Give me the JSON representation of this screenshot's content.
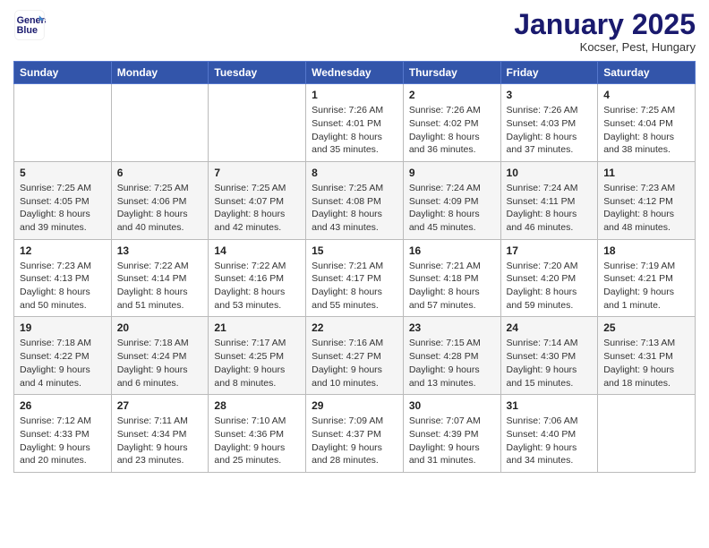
{
  "header": {
    "logo_line1": "General",
    "logo_line2": "Blue",
    "month": "January 2025",
    "location": "Kocser, Pest, Hungary"
  },
  "weekdays": [
    "Sunday",
    "Monday",
    "Tuesday",
    "Wednesday",
    "Thursday",
    "Friday",
    "Saturday"
  ],
  "weeks": [
    [
      {
        "day": "",
        "info": ""
      },
      {
        "day": "",
        "info": ""
      },
      {
        "day": "",
        "info": ""
      },
      {
        "day": "1",
        "info": "Sunrise: 7:26 AM\nSunset: 4:01 PM\nDaylight: 8 hours and 35 minutes."
      },
      {
        "day": "2",
        "info": "Sunrise: 7:26 AM\nSunset: 4:02 PM\nDaylight: 8 hours and 36 minutes."
      },
      {
        "day": "3",
        "info": "Sunrise: 7:26 AM\nSunset: 4:03 PM\nDaylight: 8 hours and 37 minutes."
      },
      {
        "day": "4",
        "info": "Sunrise: 7:25 AM\nSunset: 4:04 PM\nDaylight: 8 hours and 38 minutes."
      }
    ],
    [
      {
        "day": "5",
        "info": "Sunrise: 7:25 AM\nSunset: 4:05 PM\nDaylight: 8 hours and 39 minutes."
      },
      {
        "day": "6",
        "info": "Sunrise: 7:25 AM\nSunset: 4:06 PM\nDaylight: 8 hours and 40 minutes."
      },
      {
        "day": "7",
        "info": "Sunrise: 7:25 AM\nSunset: 4:07 PM\nDaylight: 8 hours and 42 minutes."
      },
      {
        "day": "8",
        "info": "Sunrise: 7:25 AM\nSunset: 4:08 PM\nDaylight: 8 hours and 43 minutes."
      },
      {
        "day": "9",
        "info": "Sunrise: 7:24 AM\nSunset: 4:09 PM\nDaylight: 8 hours and 45 minutes."
      },
      {
        "day": "10",
        "info": "Sunrise: 7:24 AM\nSunset: 4:11 PM\nDaylight: 8 hours and 46 minutes."
      },
      {
        "day": "11",
        "info": "Sunrise: 7:23 AM\nSunset: 4:12 PM\nDaylight: 8 hours and 48 minutes."
      }
    ],
    [
      {
        "day": "12",
        "info": "Sunrise: 7:23 AM\nSunset: 4:13 PM\nDaylight: 8 hours and 50 minutes."
      },
      {
        "day": "13",
        "info": "Sunrise: 7:22 AM\nSunset: 4:14 PM\nDaylight: 8 hours and 51 minutes."
      },
      {
        "day": "14",
        "info": "Sunrise: 7:22 AM\nSunset: 4:16 PM\nDaylight: 8 hours and 53 minutes."
      },
      {
        "day": "15",
        "info": "Sunrise: 7:21 AM\nSunset: 4:17 PM\nDaylight: 8 hours and 55 minutes."
      },
      {
        "day": "16",
        "info": "Sunrise: 7:21 AM\nSunset: 4:18 PM\nDaylight: 8 hours and 57 minutes."
      },
      {
        "day": "17",
        "info": "Sunrise: 7:20 AM\nSunset: 4:20 PM\nDaylight: 8 hours and 59 minutes."
      },
      {
        "day": "18",
        "info": "Sunrise: 7:19 AM\nSunset: 4:21 PM\nDaylight: 9 hours and 1 minute."
      }
    ],
    [
      {
        "day": "19",
        "info": "Sunrise: 7:18 AM\nSunset: 4:22 PM\nDaylight: 9 hours and 4 minutes."
      },
      {
        "day": "20",
        "info": "Sunrise: 7:18 AM\nSunset: 4:24 PM\nDaylight: 9 hours and 6 minutes."
      },
      {
        "day": "21",
        "info": "Sunrise: 7:17 AM\nSunset: 4:25 PM\nDaylight: 9 hours and 8 minutes."
      },
      {
        "day": "22",
        "info": "Sunrise: 7:16 AM\nSunset: 4:27 PM\nDaylight: 9 hours and 10 minutes."
      },
      {
        "day": "23",
        "info": "Sunrise: 7:15 AM\nSunset: 4:28 PM\nDaylight: 9 hours and 13 minutes."
      },
      {
        "day": "24",
        "info": "Sunrise: 7:14 AM\nSunset: 4:30 PM\nDaylight: 9 hours and 15 minutes."
      },
      {
        "day": "25",
        "info": "Sunrise: 7:13 AM\nSunset: 4:31 PM\nDaylight: 9 hours and 18 minutes."
      }
    ],
    [
      {
        "day": "26",
        "info": "Sunrise: 7:12 AM\nSunset: 4:33 PM\nDaylight: 9 hours and 20 minutes."
      },
      {
        "day": "27",
        "info": "Sunrise: 7:11 AM\nSunset: 4:34 PM\nDaylight: 9 hours and 23 minutes."
      },
      {
        "day": "28",
        "info": "Sunrise: 7:10 AM\nSunset: 4:36 PM\nDaylight: 9 hours and 25 minutes."
      },
      {
        "day": "29",
        "info": "Sunrise: 7:09 AM\nSunset: 4:37 PM\nDaylight: 9 hours and 28 minutes."
      },
      {
        "day": "30",
        "info": "Sunrise: 7:07 AM\nSunset: 4:39 PM\nDaylight: 9 hours and 31 minutes."
      },
      {
        "day": "31",
        "info": "Sunrise: 7:06 AM\nSunset: 4:40 PM\nDaylight: 9 hours and 34 minutes."
      },
      {
        "day": "",
        "info": ""
      }
    ]
  ]
}
